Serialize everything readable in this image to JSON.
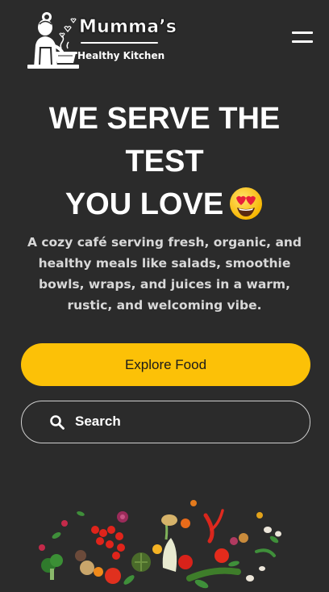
{
  "header": {
    "brand_title": "Mumma’s",
    "brand_subtitle": "Healthy Kitchen",
    "logo_icon": "chef-mother-cooking-icon",
    "menu_icon": "hamburger-menu-icon"
  },
  "hero": {
    "title_line1": "WE SERVE THE",
    "title_line2": "TEST",
    "title_line3": "YOU LOVE",
    "title_emoji": "heart-eyes-emoji",
    "description": "A cozy café serving fresh, organic, and healthy meals like salads, smoothie bowls, wraps, and juices in a warm, rustic, and welcoming vibe."
  },
  "actions": {
    "explore_label": "Explore Food",
    "search_label": "Search",
    "search_icon": "search-icon"
  },
  "colors": {
    "background": "#2b2b2b",
    "accent": "#fcc107",
    "text": "#ffffff",
    "muted_text": "#d8d8d8"
  },
  "decor": {
    "image": "fresh-vegetables-illustration"
  }
}
